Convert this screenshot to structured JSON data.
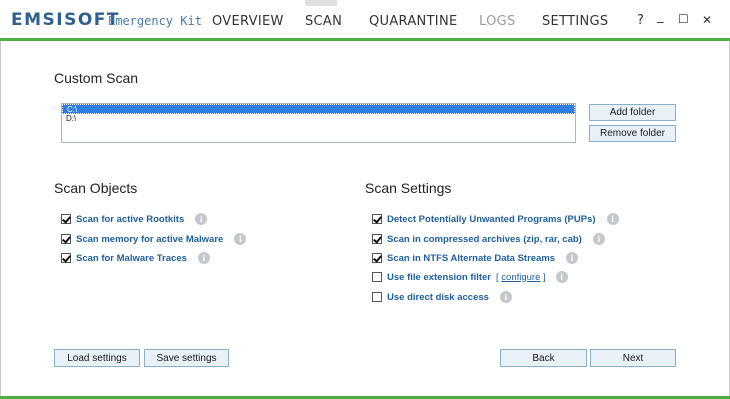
{
  "app": {
    "logo": "EMSISOFT",
    "logo_sub": "Emergency Kit"
  },
  "nav": {
    "overview": "OVERVIEW",
    "scan": "SCAN",
    "quarantine": "QUARANTINE",
    "logs": "LOGS",
    "settings": "SETTINGS"
  },
  "window": {
    "help": "?",
    "minimize": "_",
    "maximize": "☐",
    "close": "✕"
  },
  "custom_scan": {
    "title": "Custom Scan",
    "folders": [
      "C:\\",
      "D:\\"
    ],
    "selected_index": 0,
    "add_folder": "Add folder",
    "remove_folder": "Remove folder"
  },
  "scan_objects": {
    "title": "Scan Objects",
    "options": [
      {
        "label": "Scan for active Rootkits",
        "checked": true
      },
      {
        "label": "Scan memory for active Malware",
        "checked": true
      },
      {
        "label": "Scan for Malware Traces",
        "checked": true
      }
    ]
  },
  "scan_settings": {
    "title": "Scan Settings",
    "options": [
      {
        "label": "Detect Potentially Unwanted Programs (PUPs)",
        "checked": true
      },
      {
        "label": "Scan in compressed archives (zip, rar, cab)",
        "checked": true
      },
      {
        "label": "Scan in NTFS Alternate Data Streams",
        "checked": true
      },
      {
        "label": "Use file extension filter",
        "checked": false
      },
      {
        "label": "Use direct disk access",
        "checked": false
      }
    ],
    "configure_open": "[",
    "configure_link": "configure",
    "configure_close": "]"
  },
  "footer": {
    "load_settings": "Load settings",
    "save_settings": "Save settings",
    "back": "Back",
    "next": "Next"
  },
  "icons": {
    "info": "info-icon",
    "checkbox": "checkbox-icon"
  },
  "colors": {
    "accent_green": "#4caf3f",
    "brand_blue": "#2f5f8f",
    "option_blue": "#1f5f9e",
    "selection_blue": "#2c7fe0"
  }
}
